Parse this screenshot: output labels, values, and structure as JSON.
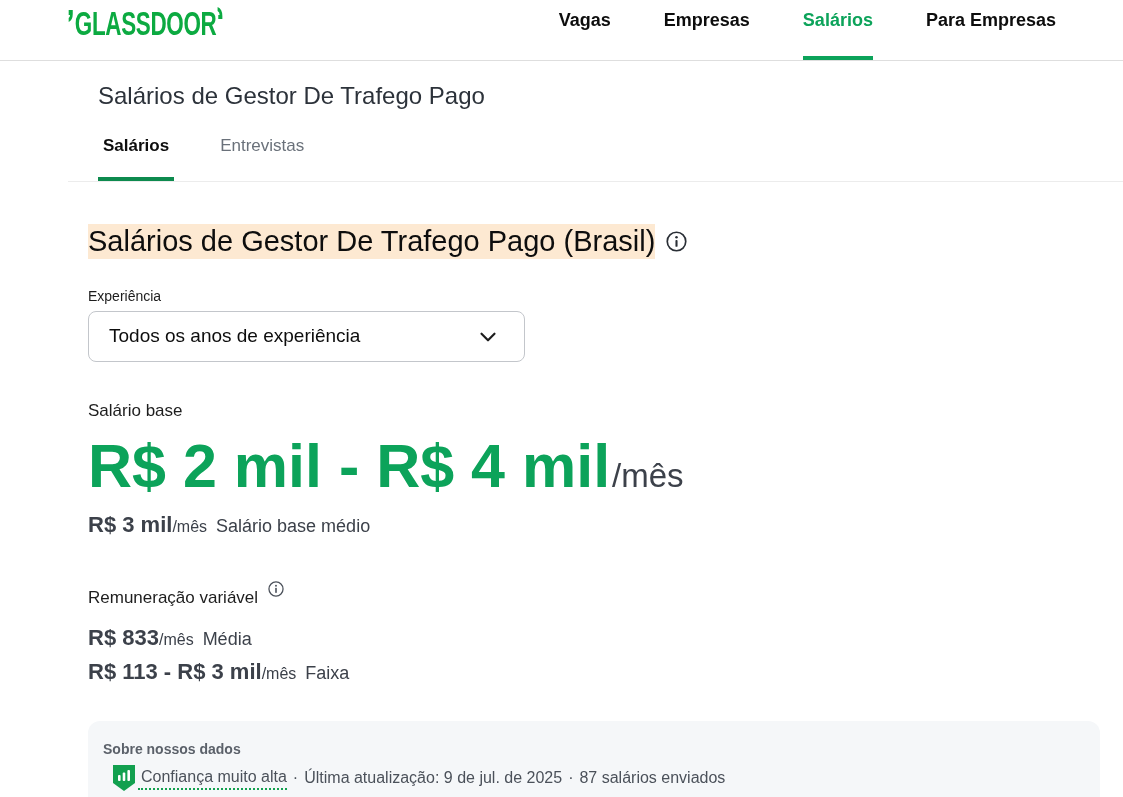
{
  "header": {
    "logo": "GLASSDOOR",
    "nav": [
      {
        "label": "Vagas",
        "selected": false
      },
      {
        "label": "Empresas",
        "selected": false
      },
      {
        "label": "Salários",
        "selected": true
      },
      {
        "label": "Para Empresas",
        "selected": false
      }
    ]
  },
  "subheader": {
    "title": "Salários de Gestor De Trafego Pago",
    "tabs": [
      {
        "label": "Salários",
        "selected": true
      },
      {
        "label": "Entrevistas",
        "selected": false
      }
    ]
  },
  "main": {
    "title": {
      "text": "Salários de Gestor De Trafego Pago (Brasil)",
      "highlighted": true
    },
    "experience": {
      "label": "Experiência",
      "value": "Todos os anos de experiência"
    },
    "base_salary": {
      "label": "Salário base",
      "range": "R$ 2 mil - R$ 4 mil",
      "period": "/mês",
      "average": "R$ 3 mil",
      "average_period": "/mês",
      "average_label": "Salário base médio"
    },
    "variable_pay": {
      "label": "Remuneração variável",
      "rows": [
        {
          "amount": "R$ 833",
          "period": "/mês",
          "caption": "Média"
        },
        {
          "amount": "R$ 113 - R$ 3 mil",
          "period": "/mês",
          "caption": "Faixa"
        }
      ]
    },
    "about_data": {
      "title": "Sobre nossos dados",
      "items": [
        {
          "kind": "confidence",
          "text": "Confiança muito alta"
        },
        {
          "kind": "separator",
          "text": "·"
        },
        {
          "kind": "text",
          "text": "Última atualização: 9 de jul. de 2025"
        },
        {
          "kind": "separator",
          "text": "·"
        },
        {
          "kind": "text",
          "text": "87 salários enviados"
        }
      ]
    }
  }
}
